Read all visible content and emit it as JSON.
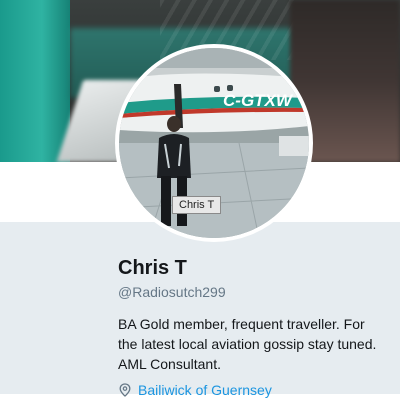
{
  "profile": {
    "avatar_tooltip": "Chris T",
    "aircraft_registration": "C-GTXW",
    "display_name": "Chris T",
    "handle": "@Radiosutch299",
    "bio": "BA Gold member, frequent traveller. For the latest local aviation gossip stay tuned. AML Consultant.",
    "location": "Bailiwick of Guernsey"
  },
  "icons": {
    "location": "map-pin-icon"
  },
  "colors": {
    "link": "#1b95e0",
    "name": "#14171a",
    "handle": "#657786",
    "card_background": "#e6ecf0"
  }
}
